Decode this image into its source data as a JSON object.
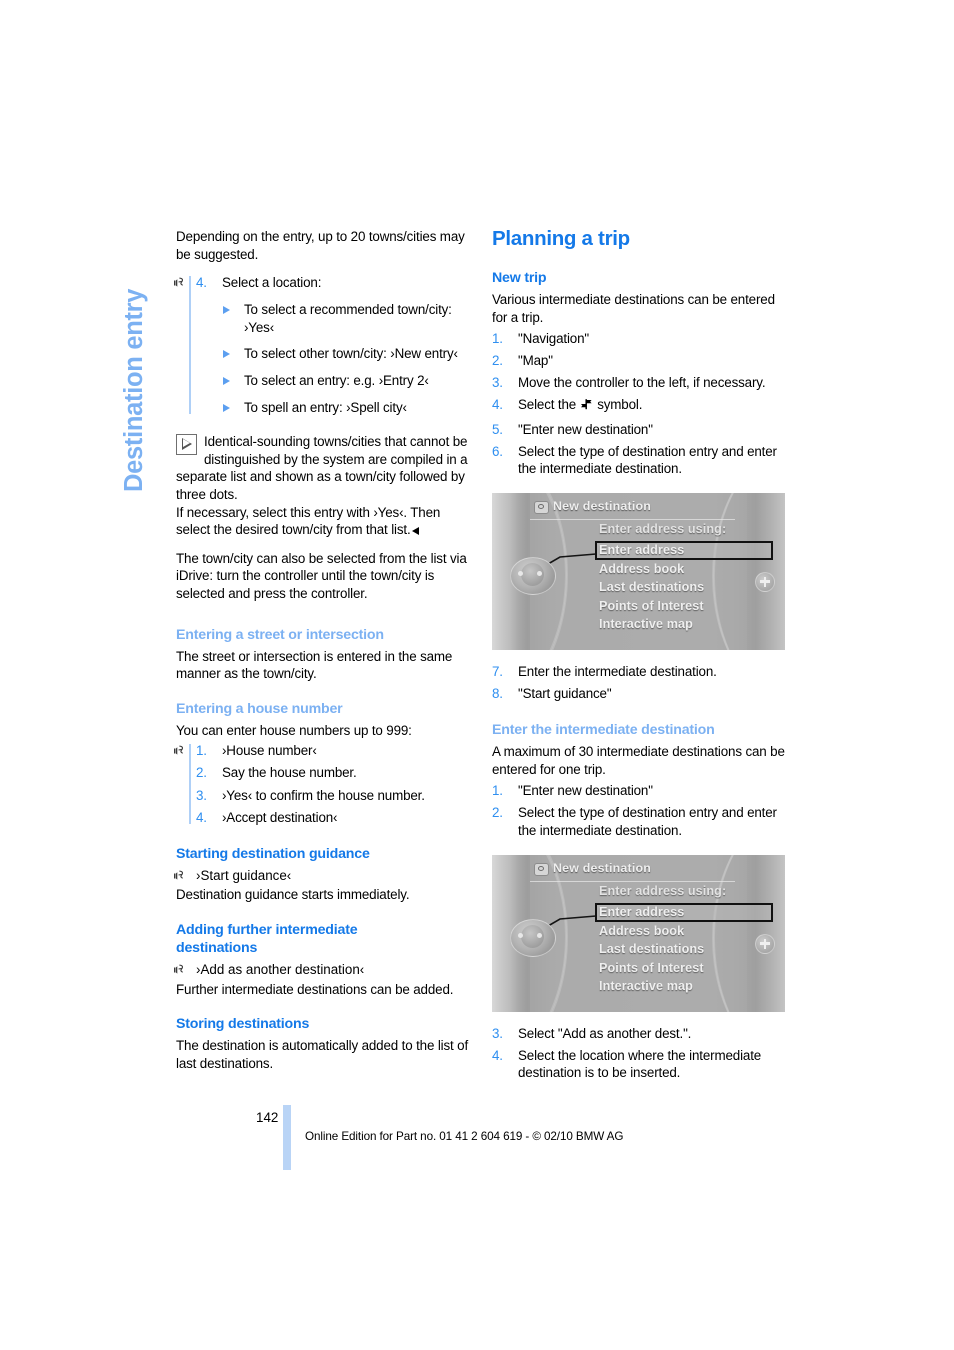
{
  "chapter": {
    "tab_title": "Destination entry"
  },
  "left_column": {
    "intro_paragraph": "Depending on the entry, up to 20 towns/cities may be suggested.",
    "select_location": {
      "number": "4.",
      "label": "Select a location:",
      "options": [
        "To select a recommended town/city: ›Yes‹",
        "To select other town/city: ›New entry‹",
        "To select an entry: e.g. ›Entry 2‹",
        "To spell an entry: ›Spell city‹"
      ]
    },
    "note": {
      "text": "Identical-sounding towns/cities that cannot be distinguished by the system are compiled in a separate list and shown as a town/city followed by three dots.",
      "text2": "If necessary, select this entry with ›Yes‹. Then select the desired town/city from that list."
    },
    "idrive_paragraph": "The town/city can also be selected from the list via iDrive: turn the controller until the town/city is selected and press the controller.",
    "sections": [
      {
        "heading": "Entering a street or intersection",
        "heading_style": "light",
        "body": "The street or intersection is entered in the same manner as the town/city."
      },
      {
        "heading": "Entering a house number",
        "heading_style": "light",
        "body": "You can enter house numbers up to 999:",
        "steps": [
          {
            "number": "1.",
            "text": "›House number‹"
          },
          {
            "number": "2.",
            "text": "Say the house number."
          },
          {
            "number": "3.",
            "text": "›Yes‹ to confirm the house number."
          },
          {
            "number": "4.",
            "text": "›Accept destination‹"
          }
        ]
      },
      {
        "heading": "Starting destination guidance",
        "heading_style": "strong",
        "command": "›Start guidance‹",
        "body": "Destination guidance starts immediately."
      },
      {
        "heading": "Adding further intermediate destinations",
        "heading_style": "strong",
        "command": "›Add as another destination‹",
        "body": "Further intermediate destinations can be added."
      },
      {
        "heading": "Storing destinations",
        "heading_style": "strong",
        "body": "The destination is automatically added to the list of last destinations."
      }
    ]
  },
  "right_column": {
    "title": "Planning a trip",
    "new_trip": {
      "heading": "New trip",
      "intro": "Various intermediate destinations can be entered for a trip.",
      "steps": [
        {
          "number": "1.",
          "text": "\"Navigation\""
        },
        {
          "number": "2.",
          "text": "\"Map\""
        },
        {
          "number": "3.",
          "text": "Move the controller to the left, if necessary."
        },
        {
          "number": "4.",
          "text_before": "Select the ",
          "symbol": "signpost-symbol",
          "text_after": " symbol."
        },
        {
          "number": "5.",
          "text": "\"Enter new destination\""
        },
        {
          "number": "6.",
          "text": "Select the type of destination entry and enter the intermediate destination."
        },
        {
          "number": "7.",
          "text": "Enter the intermediate destination."
        },
        {
          "number": "8.",
          "text": "\"Start guidance\""
        }
      ]
    },
    "enter_intermediate": {
      "heading": "Enter the intermediate destination",
      "intro": "A maximum of 30 intermediate destinations can be entered for one trip.",
      "steps": [
        {
          "number": "1.",
          "text": "\"Enter new destination\""
        },
        {
          "number": "2.",
          "text": "Select the type of destination entry and enter the intermediate destination."
        },
        {
          "number": "3.",
          "text": "Select \"Add as another dest.\"."
        },
        {
          "number": "4.",
          "text": "Select the location where the intermediate destination is to be inserted."
        }
      ]
    }
  },
  "idrive_screen": {
    "title": "New destination",
    "subtitle": "Enter address using:",
    "items": [
      "Enter address",
      "Address book",
      "Last destinations",
      "Points of Interest",
      "Interactive map"
    ],
    "selected_index": 0
  },
  "footer": {
    "page_number": "142",
    "text": "Online Edition for Part no. 01 41 2 604 619 - © 02/10 BMW AG"
  },
  "colors": {
    "heading_strong": "#1479E8",
    "heading_light": "#7CB1F2",
    "number_blue": "#2F8FF0",
    "rule_blue": "#AFD0F7",
    "footer_bar": "#B9D4F6"
  }
}
